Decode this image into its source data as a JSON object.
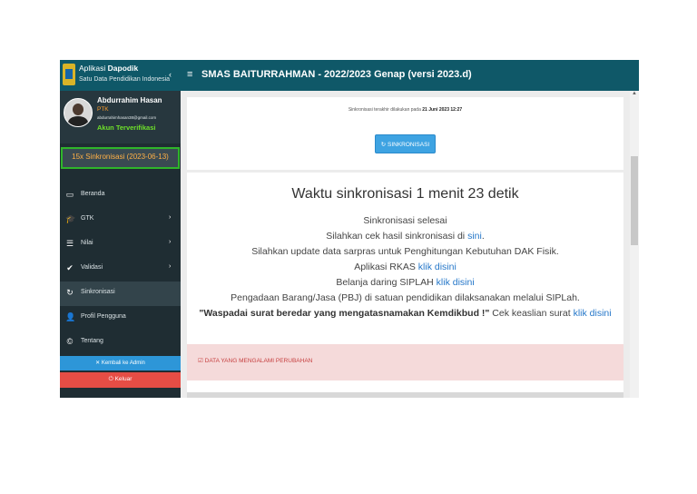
{
  "brand": {
    "line1_prefix": "Aplikasi ",
    "line1_bold": "Dapodik",
    "line2": "Satu Data Pendidikan Indonesia",
    "collapse_icon": "‹"
  },
  "user": {
    "name": "Abdurrahim Hasan",
    "role": "PTK",
    "email": "abdurrahimhasan38@gmail.com",
    "status": "Akun Terverifikasi"
  },
  "sync_badge": "15x Sinkronisasi (2023-06-13)",
  "nav": [
    {
      "label": "Beranda",
      "icon": "monitor-icon",
      "glyph": "▭",
      "arrow": ""
    },
    {
      "label": "GTK",
      "icon": "graduation-cap-icon",
      "glyph": "🎓",
      "arrow": "›"
    },
    {
      "label": "Nilai",
      "icon": "list-icon",
      "glyph": "☰",
      "arrow": "›"
    },
    {
      "label": "Validasi",
      "icon": "check-icon",
      "glyph": "✔",
      "arrow": "›"
    },
    {
      "label": "Sinkronisasi",
      "icon": "sync-icon",
      "glyph": "↻",
      "arrow": ""
    },
    {
      "label": "Profil Pengguna",
      "icon": "user-icon",
      "glyph": "👤",
      "arrow": ""
    },
    {
      "label": "Tentang",
      "icon": "copyright-icon",
      "glyph": "©",
      "arrow": ""
    }
  ],
  "btn_admin": "✕ Kembali ke Admin",
  "btn_keluar": "⏻ Keluar",
  "header": {
    "menu_icon": "≡",
    "title": "SMAS BAITURRAHMAN - 2022/2023 Genap (versi 2023.d)"
  },
  "last_sync": {
    "prefix": "Sinkronisasi terakhir dilakukan pada ",
    "date": "21 Juni 2023 12:27"
  },
  "sync_button": "↻ SINKRONISASI",
  "result": {
    "durasi": "Waktu sinkronisasi 1 menit 23 detik",
    "l1": "Sinkronisasi selesai",
    "l2_text": "Silahkan cek hasil sinkronisasi di ",
    "l2_link": "sini",
    "l2_end": ".",
    "l3": "Silahkan update data sarpras untuk Penghitungan Kebutuhan DAK Fisik.",
    "l4_text": "Aplikasi RKAS ",
    "l4_link": "klik disini",
    "l5_text": "Belanja daring SIPLAH ",
    "l5_link": "klik disini",
    "l6": "Pengadaan Barang/Jasa (PBJ) di satuan pendidikan dilaksanakan melalui SIPLah.",
    "l7_bold": "\"Waspadai surat beredar yang mengatasnamakan Kemdikbud !\"",
    "l7_text": " Cek keaslian surat ",
    "l7_link": "klik disini"
  },
  "alert": "☑ DATA YANG MENGALAMI PERUBAHAN"
}
